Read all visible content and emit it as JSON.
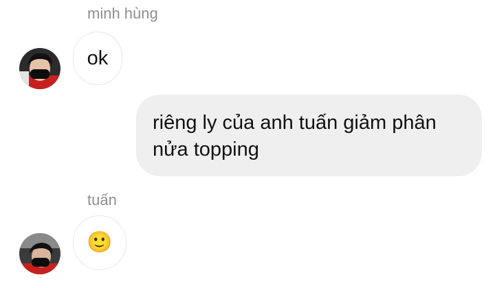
{
  "conversation": {
    "messages": [
      {
        "sender": "minh hùng",
        "direction": "incoming",
        "avatar_icon": "avatar-minh-hung",
        "text": "ok"
      },
      {
        "direction": "outgoing",
        "text": "riêng ly của anh tuấn giảm phân nửa topping"
      },
      {
        "sender": "tuấn",
        "direction": "incoming",
        "avatar_icon": "avatar-tuan",
        "text": "🙂"
      }
    ]
  },
  "colors": {
    "background": "#ffffff",
    "sender_name": "#8e8e8e",
    "incoming_bubble_border": "#e6e6e6",
    "outgoing_bubble_bg": "#efefef",
    "message_text": "#111111",
    "emoji_face": "#f5c13b"
  }
}
